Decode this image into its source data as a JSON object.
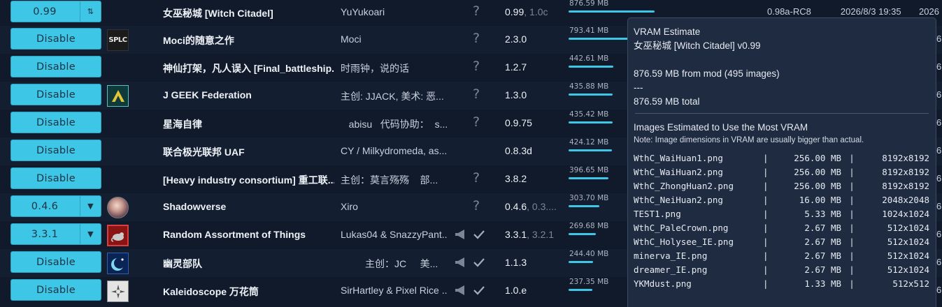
{
  "rows": [
    {
      "control": "0.99",
      "control_tail": "⇅",
      "name": "女巫秘城 [Witch Citadel]",
      "author": "YuYukoari",
      "unknown": "?",
      "version": "0.99",
      "version_sub": ", 1.0c",
      "vram": "876.59 MB",
      "vram_fraction": 0.14,
      "extra": "0.98a-RC8",
      "date": "2026/8/3 19:35",
      "edge": "2026"
    },
    {
      "control": "Disable",
      "thumb": "SPLC",
      "name": "Moci的随意之作",
      "author": "Moci",
      "unknown": "?",
      "version": "2.3.0",
      "vram": "793.41 MB",
      "vram_fraction": 0.13,
      "edge": "6"
    },
    {
      "control": "Disable",
      "name": "神仙打架，凡人误入 [Final_battleship...",
      "author": "时雨钟，说的话",
      "unknown": "?",
      "version": "1.2.7",
      "vram": "442.61 MB",
      "vram_fraction": 0.073,
      "edge": "6"
    },
    {
      "control": "Disable",
      "name": "J GEEK Federation",
      "author": "主创: JJACK, 美术: 恶...",
      "unknown": "?",
      "version": "1.3.0",
      "vram": "435.88 MB",
      "vram_fraction": 0.072,
      "edge": "6"
    },
    {
      "control": "Disable",
      "name": "星海自律",
      "author": "   abisu   代码协助：  s...",
      "unknown": "?",
      "version": "0.9.75",
      "vram": "435.42 MB",
      "vram_fraction": 0.072,
      "edge": "6"
    },
    {
      "control": "Disable",
      "name": "联合极光联邦 UAF",
      "author": "CY / Milkydromeda, as...",
      "version": "0.8.3d",
      "vram": "424.12 MB",
      "vram_fraction": 0.07,
      "edge": "6"
    },
    {
      "control": "Disable",
      "name": "[Heavy industry consortium] 重工联...",
      "author": "主创：莫言殇殇    部...",
      "unknown": "?",
      "version": "3.8.2",
      "vram": "396.65 MB",
      "vram_fraction": 0.065,
      "edge": "6"
    },
    {
      "control": "0.4.6",
      "control_tail": "▼",
      "name": "Shadowverse",
      "author": "Xiro",
      "unknown": "?",
      "version": "0.4.6",
      "version_sub": ", 0.3....",
      "vram": "303.70 MB",
      "vram_fraction": 0.05,
      "edge": "6"
    },
    {
      "control": "3.3.1",
      "control_tail": "▼",
      "name": "Random Assortment of Things",
      "author": "Lukas04 & SnazzyPant...",
      "verified": true,
      "version": "3.3.1",
      "version_sub": ", 3.2.1",
      "vram": "269.68 MB",
      "vram_fraction": 0.044,
      "edge": "6"
    },
    {
      "control": "Disable",
      "name": "幽灵部队",
      "author": "         主创：JC     美...",
      "verified": true,
      "version": "1.1.3",
      "vram": "244.40 MB",
      "vram_fraction": 0.04,
      "edge": "6"
    },
    {
      "control": "Disable",
      "name": "Kaleidoscope 万花筒",
      "author": "SirHartley & Pixel Rice ...",
      "verified": true,
      "version": "1.0.e",
      "vram": "237.35 MB",
      "vram_fraction": 0.039,
      "edge": "6"
    }
  ],
  "tooltip": {
    "title": "VRAM Estimate",
    "mod_name": "女巫秘城 [Witch Citadel] v0.99",
    "summary_line": "876.59 MB from mod (495 images)",
    "divider": "---",
    "total_line": "876.59 MB total",
    "section_title": "Images Estimated to Use the Most VRAM",
    "note": "Note: Image dimensions in VRAM are usually bigger than actual.",
    "images": [
      {
        "file": "WthC_WaiHuan1.png",
        "size": "256.00 MB",
        "dims": "8192x8192"
      },
      {
        "file": "WthC_WaiHuan2.png",
        "size": "256.00 MB",
        "dims": "8192x8192"
      },
      {
        "file": "WthC_ZhongHuan2.png",
        "size": "256.00 MB",
        "dims": "8192x8192"
      },
      {
        "file": "WthC_NeiHuan2.png",
        "size": "16.00 MB",
        "dims": "2048x2048"
      },
      {
        "file": "TEST1.png",
        "size": "5.33 MB",
        "dims": "1024x1024"
      },
      {
        "file": "WthC_PaleCrown.png",
        "size": "2.67 MB",
        "dims": "512x1024"
      },
      {
        "file": "WthC_Holysee_IE.png",
        "size": "2.67 MB",
        "dims": "512x1024"
      },
      {
        "file": "minerva_IE.png",
        "size": "2.67 MB",
        "dims": "512x1024"
      },
      {
        "file": "dreamer_IE.png",
        "size": "2.67 MB",
        "dims": "512x1024"
      },
      {
        "file": "YKMdust.png",
        "size": "1.33 MB",
        "dims": "512x512"
      }
    ]
  },
  "colors": {
    "accent": "#3ec6e7",
    "background": "#101a2b",
    "tooltip_bg": "#1e2b40"
  }
}
